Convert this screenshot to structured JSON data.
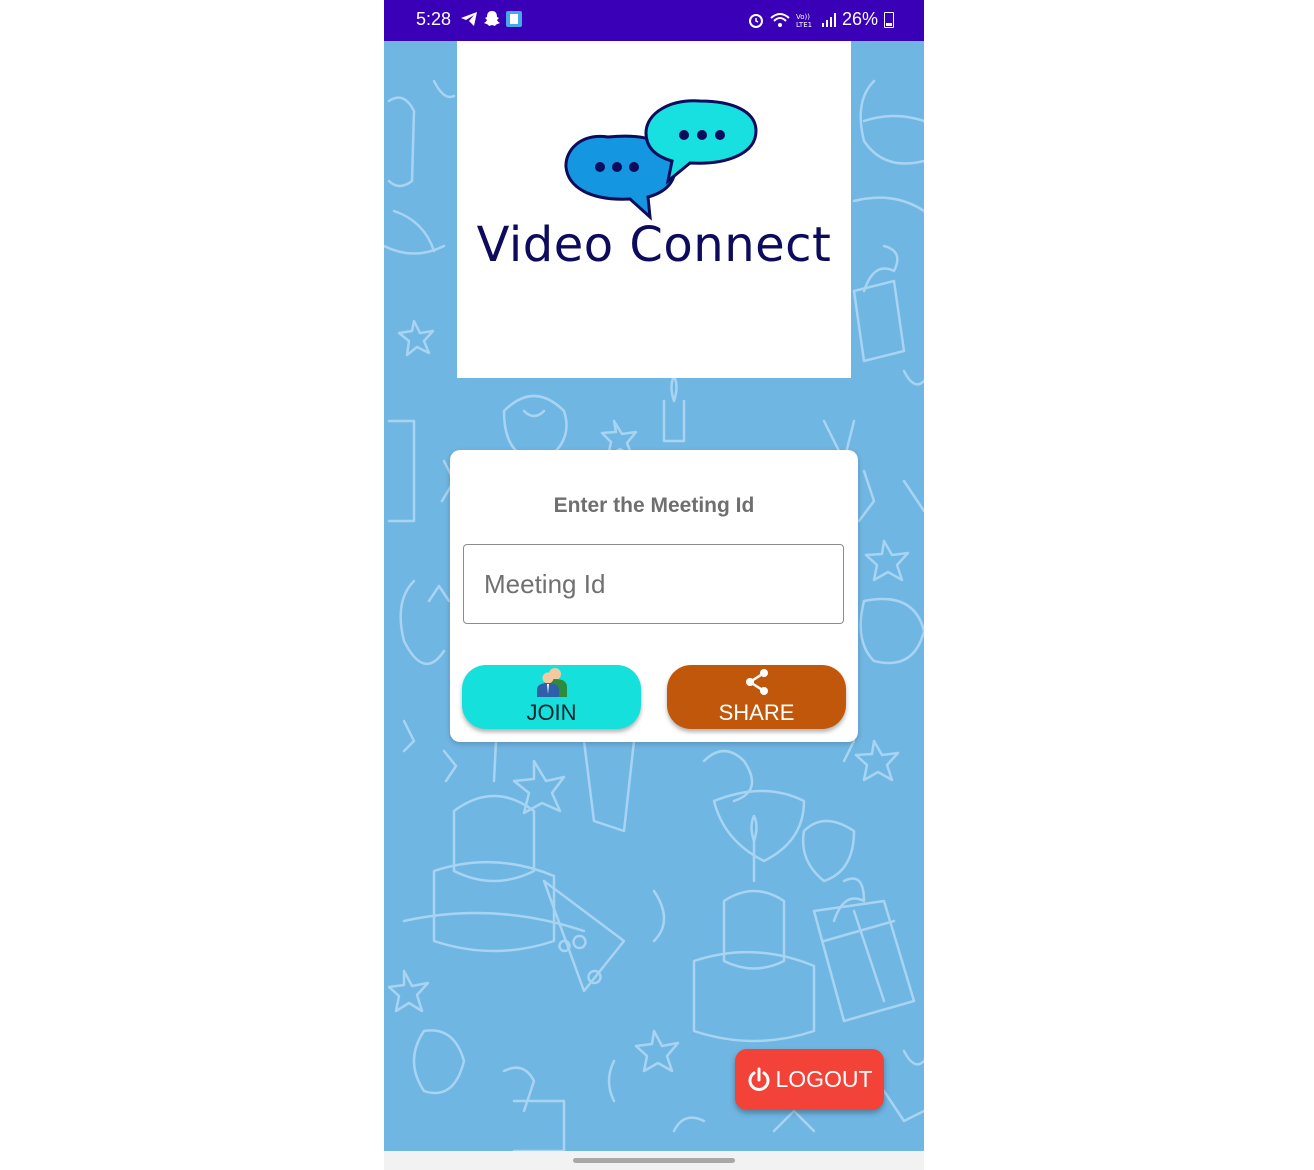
{
  "status_bar": {
    "time": "5:28",
    "battery": "26%",
    "color": "#3a00b8",
    "left_icons": [
      "telegram-icon",
      "snapchat-icon",
      "app-notification-icon"
    ],
    "right_icons": [
      "alarm-icon",
      "wifi-icon",
      "volte-icon",
      "signal-icon",
      "battery-icon"
    ]
  },
  "logo": {
    "title": "Video Connect",
    "icon": "chat-bubbles-icon"
  },
  "card": {
    "heading": "Enter the Meeting Id",
    "input_placeholder": "Meeting Id",
    "input_value": "",
    "join_label": "JOIN",
    "join_icon": "people-icon",
    "share_label": "SHARE",
    "share_icon": "share-icon"
  },
  "logout": {
    "label": "LOGOUT",
    "icon": "power-icon"
  },
  "colors": {
    "background": "#70b6e3",
    "join": "#16e0dc",
    "share": "#c1570a",
    "logout": "#f34237",
    "title": "#0d0b5b"
  }
}
